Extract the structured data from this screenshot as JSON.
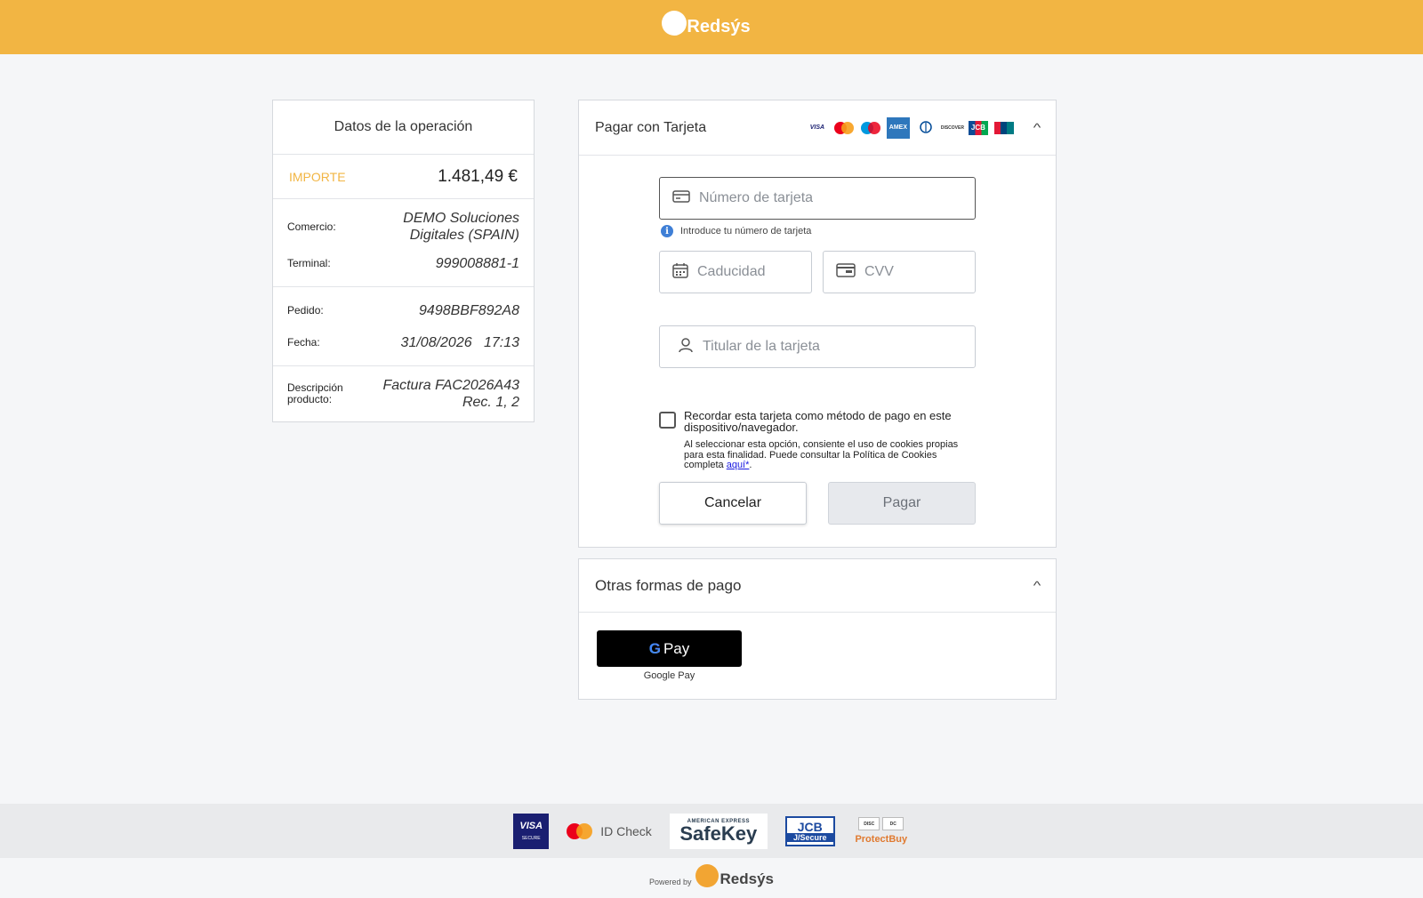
{
  "header": {
    "brand": "Redsýs",
    "logo_icon": "redsys-logo-icon"
  },
  "operation": {
    "title": "Datos de la operación",
    "amount_label": "IMPORTE",
    "amount_value": "1.481,49 €",
    "rows": {
      "comercio_label": "Comercio:",
      "comercio_value": "DEMO Soluciones Digitales (SPAIN)",
      "terminal_label": "Terminal:",
      "terminal_value": "999008881-1",
      "pedido_label": "Pedido:",
      "pedido_value": "9498BBF892A8",
      "fecha_label": "Fecha:",
      "fecha_value": "31/08/2026   17:13",
      "desc_label": "Descripción producto:",
      "desc_value": "Factura FAC2026A43 Rec. 1, 2"
    }
  },
  "card_payment": {
    "title": "Pagar con Tarjeta",
    "brands": {
      "visa": "VISA",
      "amex": "AMEX",
      "discover": "DISCOVER",
      "jcb": "JCB"
    },
    "card_number_placeholder": "Número de tarjeta",
    "card_number_hint": "Introduce tu número de tarjeta",
    "expiry_placeholder": "Caducidad",
    "cvv_placeholder": "CVV",
    "holder_placeholder": "Titular de la tarjeta",
    "remember_label": "Recordar esta tarjeta como método de pago en este dispositivo/navegador.",
    "remember_note": "Al seleccionar esta opción, consiente el uso de cookies propias para esta finalidad. Puede consultar la Política de Cookies completa",
    "remember_link": "aquí*",
    "cancel_label": "Cancelar",
    "pay_label": "Pagar"
  },
  "other_payment": {
    "title": "Otras formas de pago",
    "gpay_button": "Pay",
    "gpay_label": "Google Pay"
  },
  "footer": {
    "visa_secure": "VISA",
    "visa_secure_sub": "SECURE",
    "id_check": "ID Check",
    "amex_top": "AMERICAN EXPRESS",
    "safekey": "SafeKey",
    "jcb_top": "JCB",
    "jcb_bottom": "J/Secure",
    "protectbuy": "ProtectBuy",
    "powered_by": "Powered by",
    "powered_brand": "Redsýs"
  },
  "colors": {
    "accent": "#f2b543",
    "background": "#f5f6f8",
    "link": "#1a1ae0"
  }
}
